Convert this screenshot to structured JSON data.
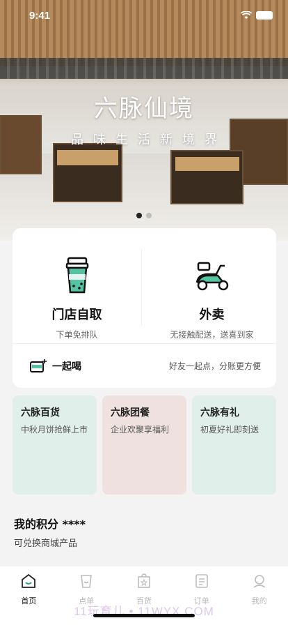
{
  "status_bar": {
    "time": "9:41"
  },
  "banner": {
    "title": "六脉仙境",
    "subtitle": "品味生活新境界",
    "page_count": 2,
    "active_index": 0
  },
  "order_options": [
    {
      "title": "门店自取",
      "desc": "下单免排队",
      "icon": "cup-icon"
    },
    {
      "title": "外卖",
      "desc": "无接触配送，送喜到家",
      "icon": "scooter-icon"
    }
  ],
  "together": {
    "label": "一起喝",
    "desc": "好友一起点，分账更方便",
    "icon": "cups-plus-icon"
  },
  "promo_tiles": [
    {
      "title": "六脉百货",
      "desc": "中秋月饼抢鲜上市"
    },
    {
      "title": "六脉团餐",
      "desc": "企业欢聚享福利"
    },
    {
      "title": "六脉有礼",
      "desc": "初夏好礼即刻送"
    }
  ],
  "points": {
    "title": "我的积分 ****",
    "subtitle": "可兑换商城产品"
  },
  "tabs": [
    {
      "label": "首页",
      "icon": "home-icon",
      "active": true
    },
    {
      "label": "点单",
      "icon": "order-cup-icon",
      "active": false
    },
    {
      "label": "百货",
      "icon": "bag-icon",
      "active": false
    },
    {
      "label": "订单",
      "icon": "receipt-icon",
      "active": false
    },
    {
      "label": "我的",
      "icon": "profile-icon",
      "active": false
    }
  ],
  "watermark": "11玩育儿 • 11WYX.COM",
  "colors": {
    "accent_green": "#2f9a7c",
    "tile_green": "#e1efea",
    "tile_pink": "#efe1df"
  }
}
